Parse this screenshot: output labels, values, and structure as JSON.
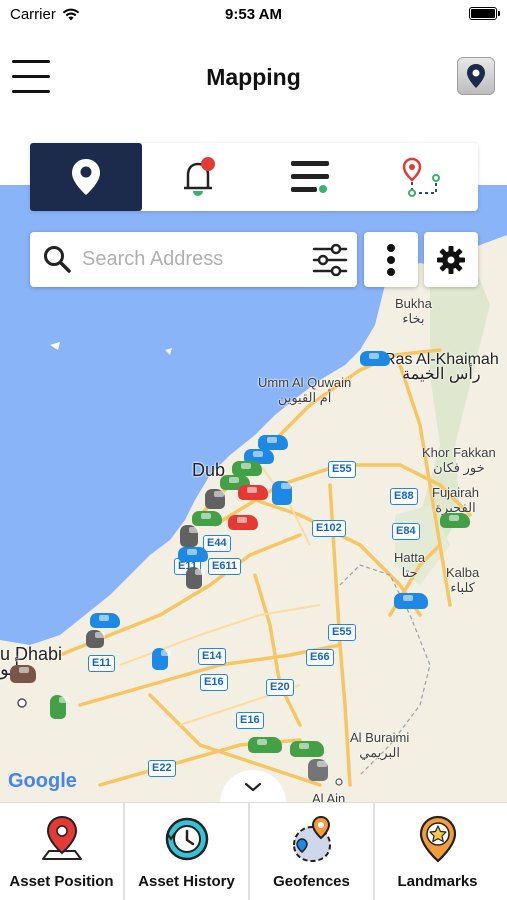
{
  "status_bar": {
    "carrier": "Carrier",
    "time": "9:53 AM"
  },
  "header": {
    "title": "Mapping"
  },
  "search": {
    "placeholder": "Search Address"
  },
  "map": {
    "labels": {
      "bukha_en": "Bukha",
      "bukha_ar": "بخاء",
      "rak_en": "Ras Al-Khaimah",
      "rak_ar": "رأس الخيمة",
      "uaq_en": "Umm Al Quwain",
      "uaq_ar": "أم القيوين",
      "dubai": "Dub",
      "khorfakkan_en": "Khor Fakkan",
      "khorfakkan_ar": "خور فكان",
      "fujairah_en": "Fujairah",
      "fujairah_ar": "الفجيرة",
      "hatta_en": "Hatta",
      "hatta_ar": "حتا",
      "kalba_en": "Kalba",
      "kalba_ar": "كلباء",
      "abudhabi_en": "u Dhabi",
      "abudhabi_ar": "أبو",
      "buraimi_en": "Al Buraimi",
      "buraimi_ar": "البريمي",
      "alain": "Al Ain"
    },
    "roads": {
      "e55a": "E55",
      "e88": "E88",
      "e102": "E102",
      "e84": "E84",
      "e44": "E44",
      "e611": "E611",
      "e11a": "E11",
      "e55b": "E55",
      "e14": "E14",
      "e66": "E66",
      "e11b": "E11",
      "e16a": "E16",
      "e20": "E20",
      "e16b": "E16",
      "e22": "E22"
    },
    "attribution": "Google",
    "colors": {
      "water": "#8ab4f8",
      "land": "#f3efe2",
      "road": "#f7c663"
    }
  },
  "bottom_nav": [
    {
      "label": "Asset Position",
      "icon": "map-marker-icon"
    },
    {
      "label": "Asset History",
      "icon": "clock-history-icon"
    },
    {
      "label": "Geofences",
      "icon": "geofence-icon"
    },
    {
      "label": "Landmarks",
      "icon": "star-marker-icon"
    }
  ]
}
